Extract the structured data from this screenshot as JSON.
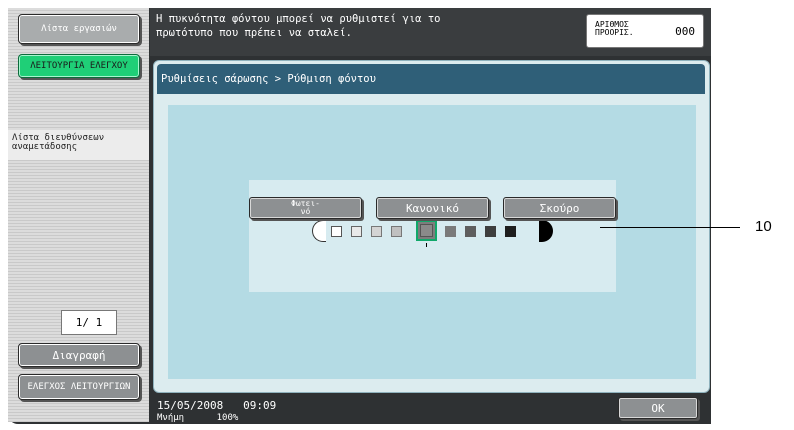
{
  "sidebar": {
    "job_list_label": "Λίστα εργασιών",
    "check_job_label": "ΛΕΙΤΟΥΡΓΙΑ ΕΛΕΓΧΟΥ",
    "address_list_label": "Λίστα διευθύνσεων αναμετάδοσης",
    "page_indicator": "1/ 1",
    "delete_label": "Διαγραφή",
    "check_functions_label": "ΕΛΕΓΧΟΣ ΛΕΙΤΟΥΡΓΙΩΝ"
  },
  "header": {
    "message": "Η πυκνότητα φόντου μπορεί να ρυθμιστεί για το\nπρωτότυπο που πρέπει να σταλεί.",
    "destination_label": "ΑΡΙΘΜΟΣ ΠΡΟΟΡΙΣ.",
    "destination_count": "000"
  },
  "panel": {
    "breadcrumb": "Ρυθμίσεις σάρωσης > Ρύθμιση φόντου"
  },
  "density": {
    "levels": 9,
    "selected_level": 5,
    "light_label": "Φωτει-\nνό",
    "normal_label": "Κανονικό",
    "dark_label": "Σκούρο"
  },
  "footer": {
    "date": "15/05/2008",
    "time": "09:09",
    "memory_label": "Μνήμη",
    "memory_value": "100%",
    "ok_label": "OK"
  },
  "callout": {
    "number": "10"
  },
  "colors": {
    "accent_green": "#1fcf77",
    "title_bar": "#2f5f78",
    "panel_bg": "#b4dbe4"
  }
}
